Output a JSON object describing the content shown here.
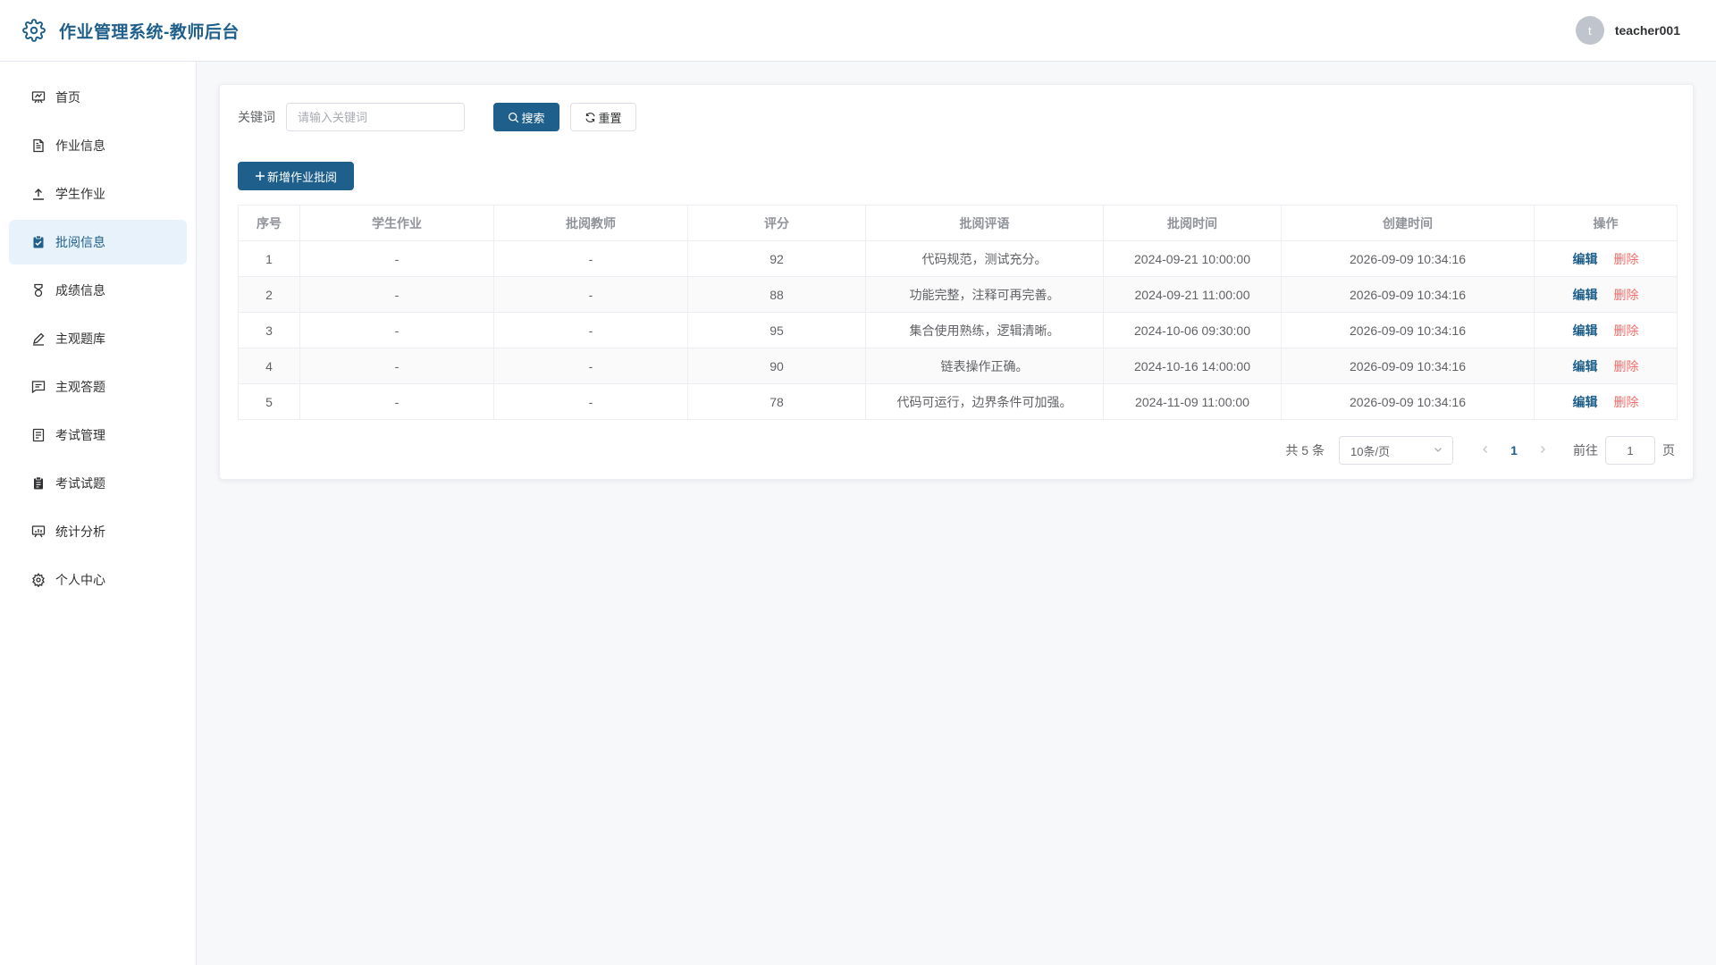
{
  "colors": {
    "brand": "#1e5f8b",
    "danger": "#f56c6c",
    "active_bg": "#e8f2fb",
    "page_bg": "#f7f8fa"
  },
  "header": {
    "title": "作业管理系统-教师后台",
    "logo_icon": "gear-icon",
    "avatar_letter": "t",
    "username": "teacher001"
  },
  "sidebar": {
    "items": [
      {
        "label": "首页",
        "icon": "presentation-board-icon",
        "active": false
      },
      {
        "label": "作业信息",
        "icon": "document-icon",
        "active": false
      },
      {
        "label": "学生作业",
        "icon": "upload-icon",
        "active": false
      },
      {
        "label": "批阅信息",
        "icon": "clipboard-check-icon",
        "active": true
      },
      {
        "label": "成绩信息",
        "icon": "medal-icon",
        "active": false
      },
      {
        "label": "主观题库",
        "icon": "edit-pen-icon",
        "active": false
      },
      {
        "label": "主观答题",
        "icon": "chat-square-icon",
        "active": false
      },
      {
        "label": "考试管理",
        "icon": "tickets-icon",
        "active": false
      },
      {
        "label": "考试试题",
        "icon": "notebook-icon",
        "active": false
      },
      {
        "label": "统计分析",
        "icon": "data-board-icon",
        "active": false
      },
      {
        "label": "个人中心",
        "icon": "setting-icon",
        "active": false
      }
    ]
  },
  "search": {
    "label": "关键词",
    "placeholder": "请输入关键词",
    "value": "",
    "search_button": "搜索",
    "reset_button": "重置"
  },
  "toolbar": {
    "add_button": "新增作业批阅"
  },
  "table": {
    "columns": [
      "序号",
      "学生作业",
      "批阅教师",
      "评分",
      "批阅评语",
      "批阅时间",
      "创建时间",
      "操作"
    ],
    "rows": [
      {
        "no": "1",
        "homework": "-",
        "teacher": "-",
        "score": "92",
        "comment": "代码规范，测试充分。",
        "review_time": "2024-09-21 10:00:00",
        "created": "2026-09-09 10:34:16"
      },
      {
        "no": "2",
        "homework": "-",
        "teacher": "-",
        "score": "88",
        "comment": "功能完整，注释可再完善。",
        "review_time": "2024-09-21 11:00:00",
        "created": "2026-09-09 10:34:16"
      },
      {
        "no": "3",
        "homework": "-",
        "teacher": "-",
        "score": "95",
        "comment": "集合使用熟练，逻辑清晰。",
        "review_time": "2024-10-06 09:30:00",
        "created": "2026-09-09 10:34:16"
      },
      {
        "no": "4",
        "homework": "-",
        "teacher": "-",
        "score": "90",
        "comment": "链表操作正确。",
        "review_time": "2024-10-16 14:00:00",
        "created": "2026-09-09 10:34:16"
      },
      {
        "no": "5",
        "homework": "-",
        "teacher": "-",
        "score": "78",
        "comment": "代码可运行，边界条件可加强。",
        "review_time": "2024-11-09 11:00:00",
        "created": "2026-09-09 10:34:16"
      }
    ],
    "edit_label": "编辑",
    "delete_label": "删除"
  },
  "pagination": {
    "total_text": "共 5 条",
    "page_size": "10条/页",
    "current_page": "1",
    "goto_label": "前往",
    "goto_value": "1",
    "goto_suffix": "页"
  }
}
